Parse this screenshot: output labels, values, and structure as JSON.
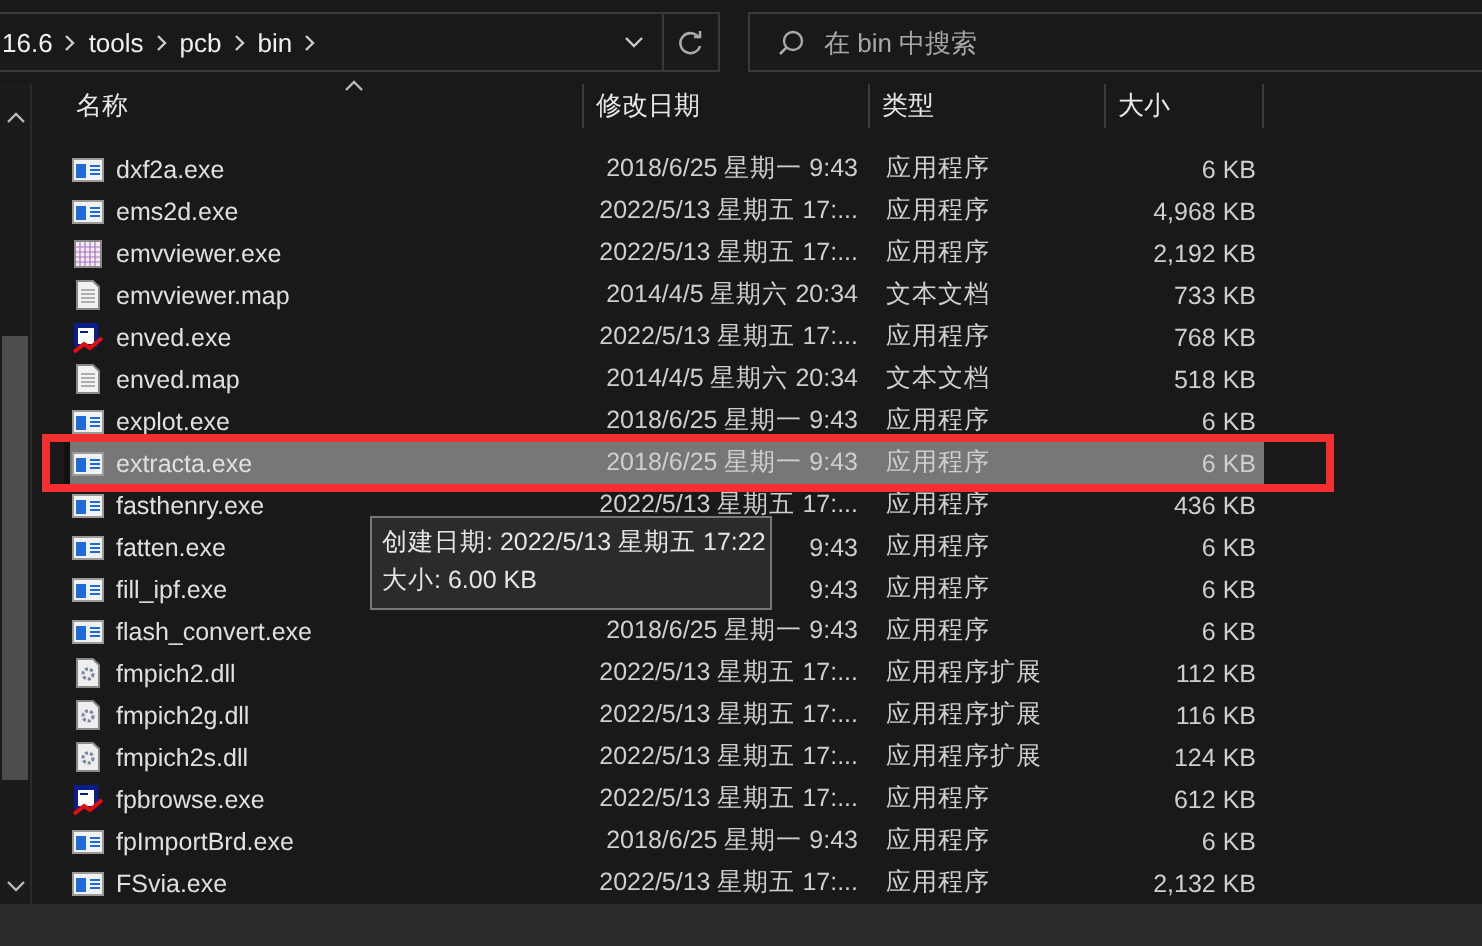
{
  "address_bar": {
    "path": [
      "16.6",
      "tools",
      "pcb",
      "bin"
    ]
  },
  "search": {
    "placeholder": "在 bin 中搜索"
  },
  "columns": [
    "名称",
    "修改日期",
    "类型",
    "大小"
  ],
  "files": [
    {
      "name": "dxf2a.exe",
      "kind": "exe",
      "date": "2018/6/25 星期一 9:43",
      "type": "应用程序",
      "size": "6 KB",
      "selected": false,
      "marked": false
    },
    {
      "name": "ems2d.exe",
      "kind": "exe",
      "date": "2022/5/13 星期五 17:...",
      "type": "应用程序",
      "size": "4,968 KB",
      "selected": false,
      "marked": false
    },
    {
      "name": "emvviewer.exe",
      "kind": "grid",
      "date": "2022/5/13 星期五 17:...",
      "type": "应用程序",
      "size": "2,192 KB",
      "selected": false,
      "marked": false
    },
    {
      "name": "emvviewer.map",
      "kind": "doc",
      "date": "2014/4/5 星期六 20:34",
      "type": "文本文档",
      "size": "733 KB",
      "selected": false,
      "marked": false
    },
    {
      "name": "enved.exe",
      "kind": "ved",
      "date": "2022/5/13 星期五 17:...",
      "type": "应用程序",
      "size": "768 KB",
      "selected": false,
      "marked": false
    },
    {
      "name": "enved.map",
      "kind": "doc",
      "date": "2014/4/5 星期六 20:34",
      "type": "文本文档",
      "size": "518 KB",
      "selected": false,
      "marked": false
    },
    {
      "name": "explot.exe",
      "kind": "exe",
      "date": "2018/6/25 星期一 9:43",
      "type": "应用程序",
      "size": "6 KB",
      "selected": false,
      "marked": false
    },
    {
      "name": "extracta.exe",
      "kind": "exe",
      "date": "2018/6/25 星期一 9:43",
      "type": "应用程序",
      "size": "6 KB",
      "selected": true,
      "marked": true
    },
    {
      "name": "fasthenry.exe",
      "kind": "exe",
      "date": "2022/5/13 星期五 17:...",
      "type": "应用程序",
      "size": "436 KB",
      "selected": false,
      "marked": false
    },
    {
      "name": "fatten.exe",
      "kind": "exe",
      "date": "9:43",
      "type": "应用程序",
      "size": "6 KB",
      "selected": false,
      "marked": false
    },
    {
      "name": "fill_ipf.exe",
      "kind": "exe",
      "date": "9:43",
      "type": "应用程序",
      "size": "6 KB",
      "selected": false,
      "marked": false
    },
    {
      "name": "flash_convert.exe",
      "kind": "exe",
      "date": "2018/6/25 星期一 9:43",
      "type": "应用程序",
      "size": "6 KB",
      "selected": false,
      "marked": false
    },
    {
      "name": "fmpich2.dll",
      "kind": "dll",
      "date": "2022/5/13 星期五 17:...",
      "type": "应用程序扩展",
      "size": "112 KB",
      "selected": false,
      "marked": false
    },
    {
      "name": "fmpich2g.dll",
      "kind": "dll",
      "date": "2022/5/13 星期五 17:...",
      "type": "应用程序扩展",
      "size": "116 KB",
      "selected": false,
      "marked": false
    },
    {
      "name": "fmpich2s.dll",
      "kind": "dll",
      "date": "2022/5/13 星期五 17:...",
      "type": "应用程序扩展",
      "size": "124 KB",
      "selected": false,
      "marked": false
    },
    {
      "name": "fpbrowse.exe",
      "kind": "ved",
      "date": "2022/5/13 星期五 17:...",
      "type": "应用程序",
      "size": "612 KB",
      "selected": false,
      "marked": false
    },
    {
      "name": "fpImportBrd.exe",
      "kind": "exe",
      "date": "2018/6/25 星期一 9:43",
      "type": "应用程序",
      "size": "6 KB",
      "selected": false,
      "marked": false
    },
    {
      "name": "FSvia.exe",
      "kind": "exe",
      "date": "2022/5/13 星期五 17:...",
      "type": "应用程序",
      "size": "2,132 KB",
      "selected": false,
      "marked": false
    }
  ],
  "tooltip": {
    "lines": [
      "创建日期: 2022/5/13 星期五 17:22",
      "大小: 6.00 KB"
    ]
  }
}
